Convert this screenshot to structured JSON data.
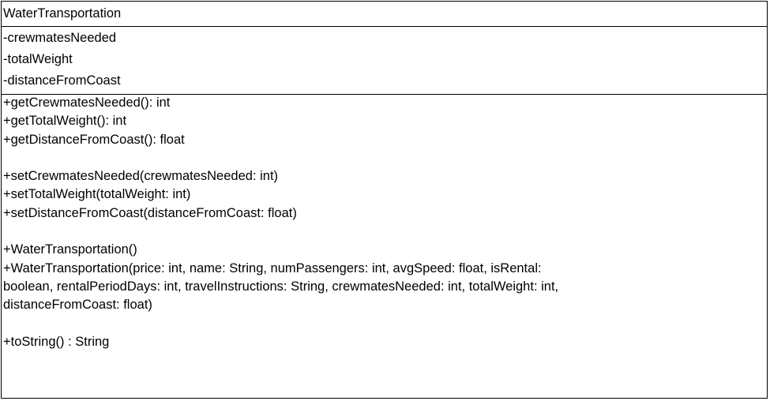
{
  "class_name": "WaterTransportation",
  "attributes": [
    "-crewmatesNeeded",
    "-totalWeight",
    "-distanceFromCoast"
  ],
  "getters": [
    "+getCrewmatesNeeded(): int",
    "+getTotalWeight(): int",
    "+getDistanceFromCoast(): float"
  ],
  "setters": [
    "+setCrewmatesNeeded(crewmatesNeeded: int)",
    "+setTotalWeight(totalWeight: int)",
    "+setDistanceFromCoast(distanceFromCoast: float)"
  ],
  "constructors": [
    "+WaterTransportation()",
    "+WaterTransportation(price: int, name: String, numPassengers: int, avgSpeed: float, isRental:",
    "boolean, rentalPeriodDays: int, travelInstructions: String, crewmatesNeeded: int, totalWeight: int,",
    "distanceFromCoast: float)"
  ],
  "other_methods": [
    "+toString() : String"
  ]
}
